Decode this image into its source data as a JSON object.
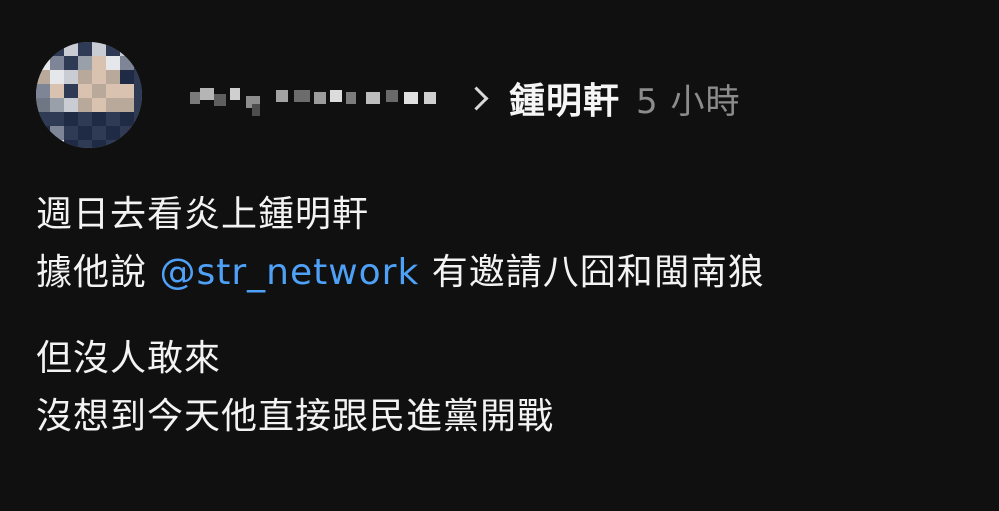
{
  "post": {
    "author": {
      "handle": "鍾明軒",
      "time_ago": "5 小時"
    },
    "paragraphs": [
      {
        "lines": [
          {
            "segments": [
              {
                "text": "週日去看炎上鍾明軒",
                "type": "text"
              }
            ]
          },
          {
            "segments": [
              {
                "text": "據他說 ",
                "type": "text"
              },
              {
                "text": "@str_network",
                "type": "mention"
              },
              {
                "text": " 有邀請八囧和閩南狼",
                "type": "text"
              }
            ]
          }
        ]
      },
      {
        "lines": [
          {
            "segments": [
              {
                "text": "但沒人敢來",
                "type": "text"
              }
            ]
          },
          {
            "segments": [
              {
                "text": "沒想到今天他直接跟民進黨開戰",
                "type": "text"
              }
            ]
          }
        ]
      }
    ]
  },
  "colors": {
    "background": "#101010",
    "text": "#f3f3f3",
    "mention": "#4ea1f7",
    "muted": "#8c8c8c"
  }
}
